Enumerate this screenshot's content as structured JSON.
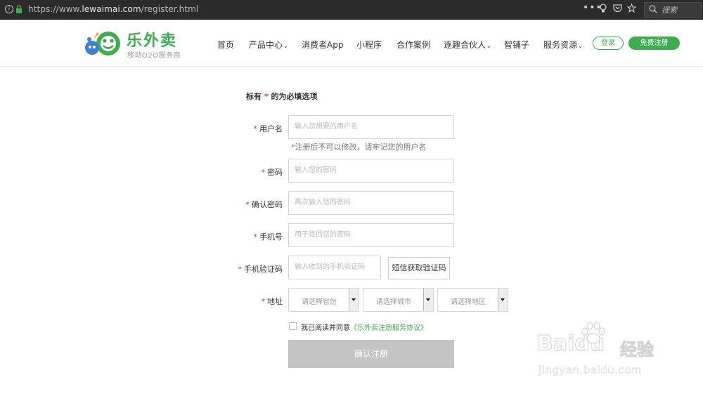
{
  "browser": {
    "url_scheme": "https://www.",
    "url_host": "lewaimai.com",
    "url_path": "/register.html",
    "more_label": "•••",
    "search_placeholder": "搜索"
  },
  "header": {
    "logo_name": "乐外卖",
    "logo_tagline": "移动O2O服务商",
    "nav": [
      {
        "label": "首页",
        "dropdown": false
      },
      {
        "label": "产品中心",
        "dropdown": true
      },
      {
        "label": "消费者App",
        "dropdown": false
      },
      {
        "label": "小程序",
        "dropdown": false
      },
      {
        "label": "合作案例",
        "dropdown": false
      },
      {
        "label": "逐趣合伙人",
        "dropdown": true
      },
      {
        "label": "智铺子",
        "dropdown": false
      },
      {
        "label": "服务资源",
        "dropdown": true
      }
    ],
    "login_label": "登录",
    "register_label": "免费注册"
  },
  "form": {
    "required_note_prefix": "标有",
    "required_star": "*",
    "required_note_suffix": "的为必填选项",
    "username": {
      "label": "用户名",
      "placeholder": "输入您想要的用户名",
      "hint": "*注册后不可以修改，请牢记您的用户名"
    },
    "password": {
      "label": "密码",
      "placeholder": "输入您的密码"
    },
    "confirm_password": {
      "label": "确认密码",
      "placeholder": "再次输入您的密码"
    },
    "phone": {
      "label": "手机号",
      "placeholder": "用于找回您的密码"
    },
    "sms_code": {
      "label": "手机验证码",
      "placeholder": "输入收到的手机验证码",
      "button": "短信获取验证码"
    },
    "address": {
      "label": "地址",
      "province": "请选择省份",
      "city": "请选择城市",
      "district": "请选择地区"
    },
    "agree_text": "我已阅读并同意",
    "agree_link": "《乐外卖注册服务协议》",
    "submit_label": "确认注册"
  },
  "watermark": {
    "brand": "Baidu",
    "brand_cn": "经验",
    "url": "jingyan.baidu.com"
  },
  "colors": {
    "brand_green": "#3dad4f",
    "required_red": "#e23b3b",
    "submit_disabled": "#c4c4c4"
  }
}
